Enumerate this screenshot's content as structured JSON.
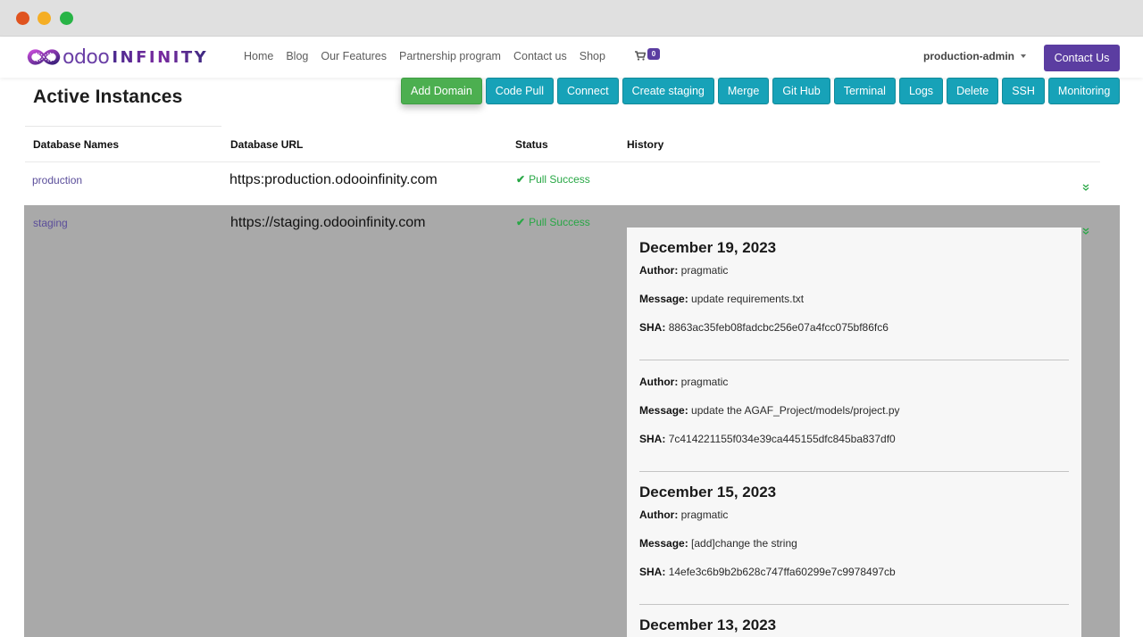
{
  "window": {
    "controls": [
      "close",
      "minimize",
      "maximize"
    ]
  },
  "brand": {
    "logo_icon": "infinity-loop-logo-icon",
    "name_part1": "odoo",
    "name_part2": "INFINITY"
  },
  "nav": {
    "links": [
      "Home",
      "Blog",
      "Our Features",
      "Partnership program",
      "Contact us",
      "Shop"
    ],
    "cart_icon": "shopping-cart-icon",
    "cart_count": "0",
    "user": "production-admin",
    "contact_button": "Contact Us"
  },
  "colors": {
    "brand_purple": "#5b3da1",
    "teal_button": "#17a2b8",
    "green_button": "#4caf50",
    "success_green": "#28a745",
    "overlay_gray": "#a9a9a9"
  },
  "page": {
    "title": "Active Instances"
  },
  "toolbar": {
    "buttons": [
      "Add Domain",
      "Code Pull",
      "Connect",
      "Create staging",
      "Merge",
      "Git Hub",
      "Terminal",
      "Logs",
      "Delete",
      "SSH",
      "Monitoring"
    ]
  },
  "table": {
    "headers": [
      "Database Names",
      "Database URL",
      "Status",
      "History"
    ],
    "rows": [
      {
        "name": "production",
        "url": "https:production.odooinfinity.com",
        "status": "Pull Success",
        "status_icon": "check-icon",
        "expand_icon": "double-chevron-down-icon"
      },
      {
        "name": "staging",
        "url": "https://staging.odooinfinity.com",
        "status": "Pull Success",
        "status_icon": "check-icon",
        "expand_icon": "double-chevron-down-icon"
      }
    ]
  },
  "history": {
    "labels": {
      "author": "Author:",
      "message": "Message:",
      "sha": "SHA:"
    },
    "entries": [
      {
        "date": "December 19, 2023",
        "author": "pragmatic",
        "message": "update requirements.txt",
        "sha": "8863ac35feb08fadcbc256e07a4fcc075bf86fc6"
      },
      {
        "date": "",
        "author": "pragmatic",
        "message": "update the AGAF_Project/models/project.py",
        "sha": "7c414221155f034e39ca445155dfc845ba837df0"
      },
      {
        "date": "December 15, 2023",
        "author": "pragmatic",
        "message": "[add]change the string",
        "sha": "14efe3c6b9b2b628c747ffa60299e7c9978497cb"
      },
      {
        "date": "December 13, 2023"
      }
    ]
  }
}
